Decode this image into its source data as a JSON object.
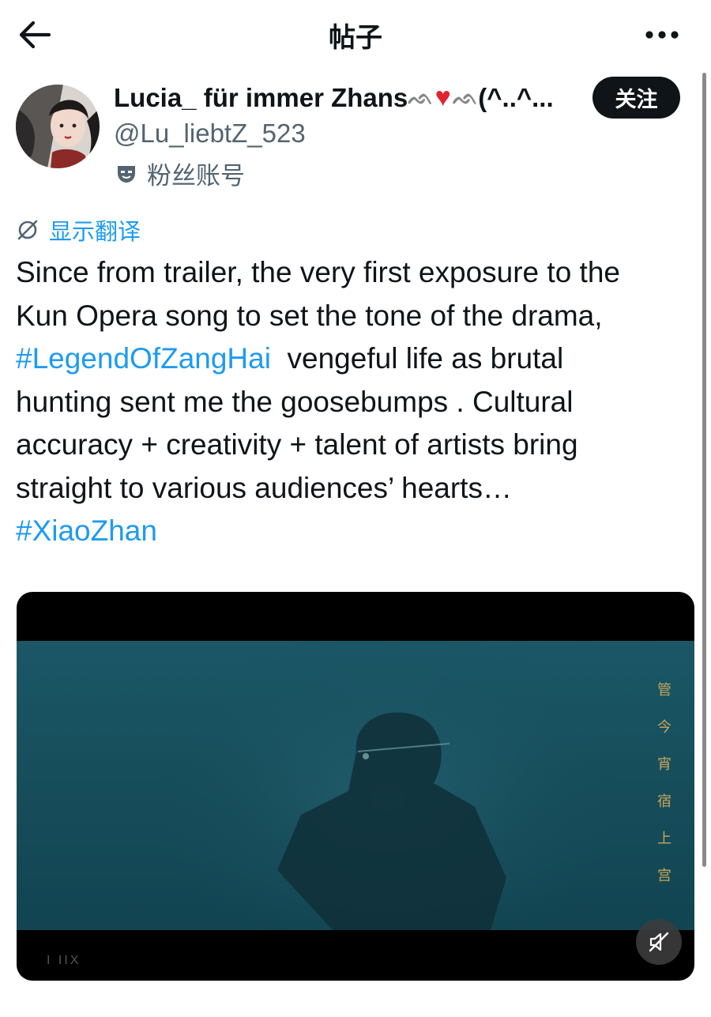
{
  "header": {
    "title": "帖子"
  },
  "author": {
    "name_prefix": "Lucia_ für immer Zhans",
    "name_suffix": "(^..^...",
    "handle": "@Lu_liebtZ_523",
    "badge_label": "粉丝账号",
    "follow_label": "关注"
  },
  "translate_label": "显示翻译",
  "post": {
    "line1": "Since from trailer, the very first exposure to the",
    "line2": "Kun Opera song to set the tone of the drama,",
    "hashtag1": "#LegendOfZangHai",
    "line3_rest": "  vengeful life as brutal",
    "line4": "hunting sent me the goosebumps . Cultural",
    "line5": "accuracy + creativity + talent of artists bring",
    "line6": "straight to various audiences’ hearts…",
    "hashtag2": "#XiaoZhan"
  },
  "video": {
    "vertical_text": [
      "管",
      "今",
      "宵",
      "宿",
      "上",
      "宫"
    ],
    "watermark": "I IIX"
  },
  "colors": {
    "link": "#1d9bf0",
    "follow_bg": "#0f1419",
    "heart": "#e0242f",
    "video_scene": "#1a5767"
  },
  "icons": [
    "back-arrow-icon",
    "more-options-icon",
    "fan-account-mask-icon",
    "translate-icon",
    "heart-emoji-icon",
    "muted-speaker-icon"
  ]
}
